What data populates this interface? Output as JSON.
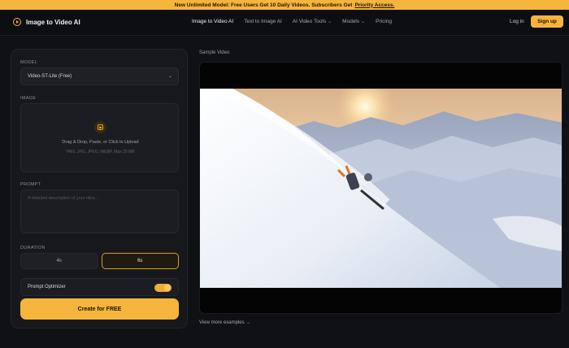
{
  "banner": {
    "text": "New Unlimited Model: Free Users Get 10 Daily Videos. Subscribers Get",
    "link": "Priority Access."
  },
  "nav": {
    "brand": "Image to Video AI",
    "items": [
      {
        "label": "Image to Video AI",
        "active": true,
        "dropdown": false
      },
      {
        "label": "Text to Image AI",
        "active": false,
        "dropdown": false
      },
      {
        "label": "AI Video Tools",
        "active": false,
        "dropdown": true
      },
      {
        "label": "Models",
        "active": false,
        "dropdown": true
      },
      {
        "label": "Pricing",
        "active": false,
        "dropdown": false
      }
    ],
    "login": "Log in",
    "signup": "Sign up"
  },
  "form": {
    "model_label": "MODEL",
    "model_value": "Video-ST-Lite (Free)",
    "image_label": "IMAGE",
    "upload_text": "Drag & Drop, Paste, or Click to Upload",
    "upload_hint": "PNG, JPG, JPEG, WEBP. Max 20 MB",
    "prompt_label": "PROMPT",
    "prompt_placeholder": "A detailed description of your idea...",
    "duration_label": "DURATION",
    "durations": [
      {
        "label": "4s",
        "selected": false
      },
      {
        "label": "6s",
        "selected": true
      }
    ],
    "optimizer_label": "Prompt Optimizer",
    "optimizer_on": true,
    "create_label": "Create for FREE"
  },
  "preview": {
    "label": "Sample Video",
    "more_link": "View more examples →"
  },
  "colors": {
    "accent": "#f5b53d",
    "background": "#101114",
    "panel": "#17181c"
  }
}
